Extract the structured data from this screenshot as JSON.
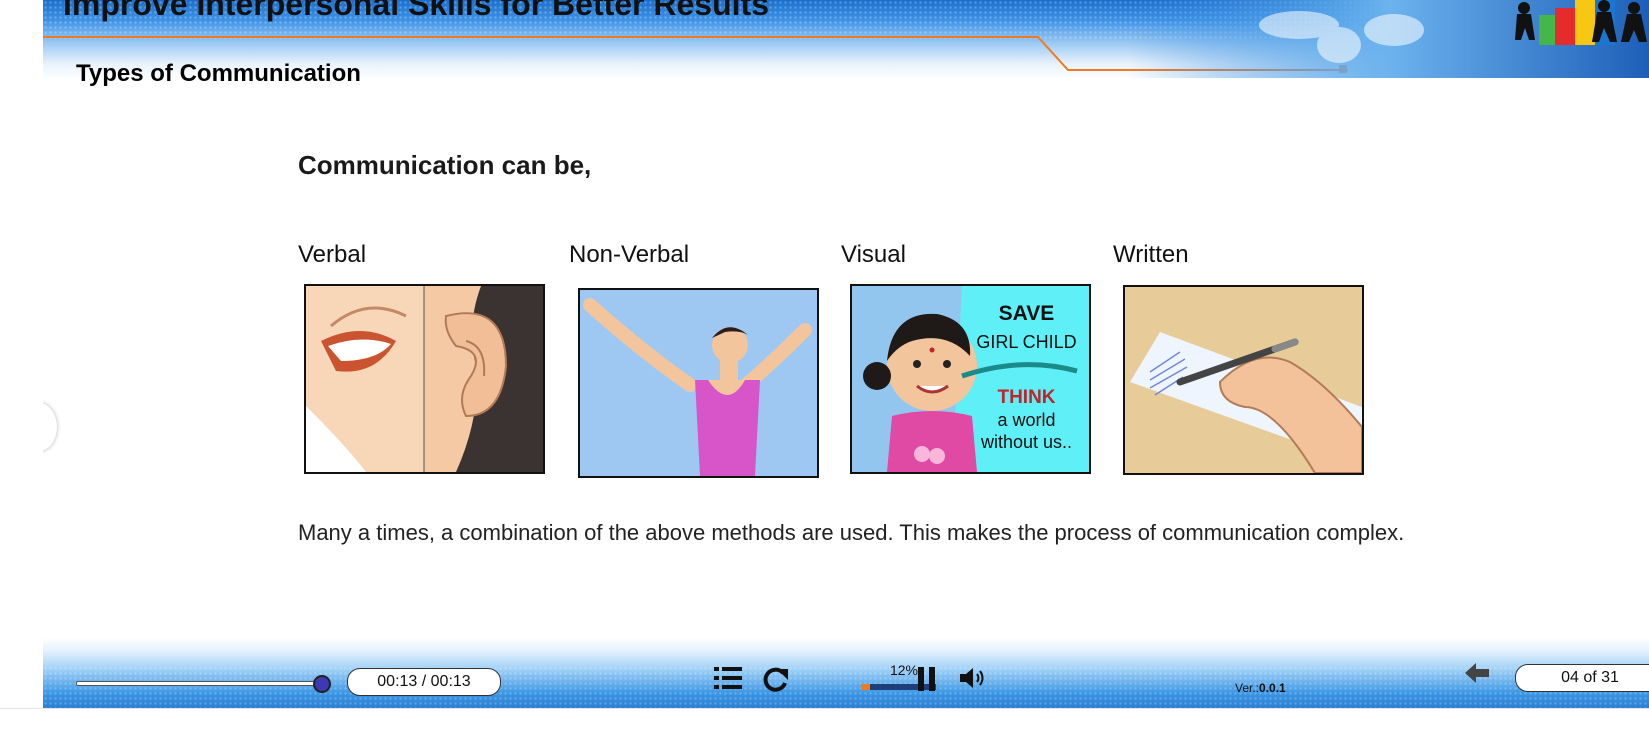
{
  "header": {
    "course_title": "Improve Interpersonal Skills for Better Results",
    "section_title": "Types of Communication"
  },
  "content": {
    "lead": "Communication can be,",
    "types": [
      {
        "label": "Verbal"
      },
      {
        "label": "Non-Verbal"
      },
      {
        "label": "Visual"
      },
      {
        "label": "Written"
      }
    ],
    "poster": {
      "line1": "SAVE",
      "line2": "GIRL CHILD",
      "line3": "THINK",
      "line4": "a world",
      "line5": "without us.."
    },
    "note": "Many a times, a combination of the above methods are used. This makes the process of communication complex."
  },
  "player": {
    "time": "00:13 / 00:13",
    "seek_fraction": 1.0,
    "progress_label": "12%",
    "progress_fraction": 0.12,
    "version_prefix": "Ver.:",
    "version_value": "0.0.1",
    "page_indicator": "04 of 31",
    "icons": [
      "menu-icon",
      "replay-icon",
      "pause-icon",
      "volume-icon",
      "back-arrow-icon"
    ]
  },
  "colors": {
    "accent_orange": "#f07a20",
    "header_blue": "#1b6fcc",
    "poster_cyan": "#5ff0f7",
    "poster_red": "#c0232a"
  }
}
